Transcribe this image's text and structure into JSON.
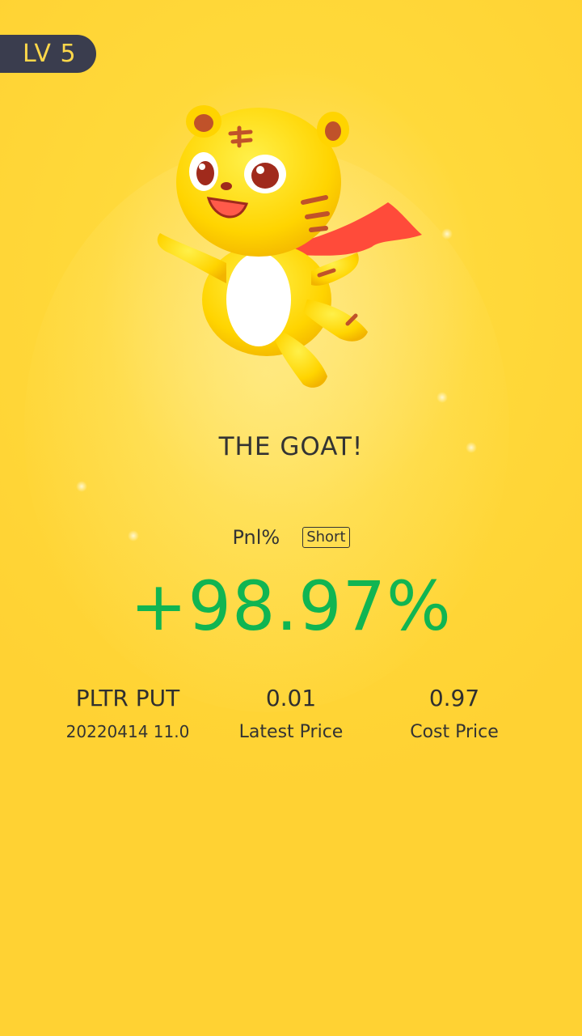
{
  "level": {
    "label": "LV 5"
  },
  "headline": "THE GOAT!",
  "pnl": {
    "label": "Pnl%",
    "direction": "Short",
    "value": "+98.97%",
    "value_color": "#10b552"
  },
  "position": {
    "symbol": "PLTR PUT",
    "contract": "20220414 11.0"
  },
  "latest": {
    "value": "0.01",
    "label": "Latest Price"
  },
  "cost": {
    "value": "0.97",
    "label": "Cost Price"
  },
  "mascot": {
    "icon": "tiger-mascot-icon"
  },
  "colors": {
    "accent": "#ffd233",
    "badge_bg": "#3a3d4e",
    "badge_text": "#ffd84a"
  }
}
